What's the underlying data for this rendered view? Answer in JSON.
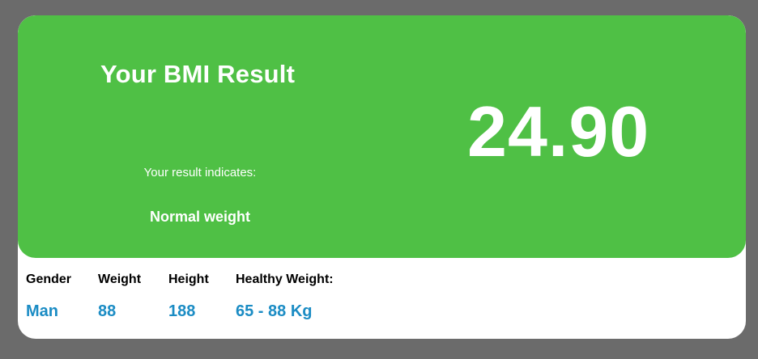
{
  "result": {
    "title": "Your BMI Result",
    "indicates_label": "Your result indicates:",
    "category": "Normal weight",
    "bmi": "24.90"
  },
  "stats": {
    "gender": {
      "label": "Gender",
      "value": "Man"
    },
    "weight": {
      "label": "Weight",
      "value": "88"
    },
    "height": {
      "label": "Height",
      "value": "188"
    },
    "healthy_weight": {
      "label": "Healthy Weight:",
      "value": "65 - 88 Kg"
    }
  },
  "colors": {
    "background": "#6b6b6b",
    "result_panel": "#4fc045",
    "value_text": "#1b8cc4"
  }
}
